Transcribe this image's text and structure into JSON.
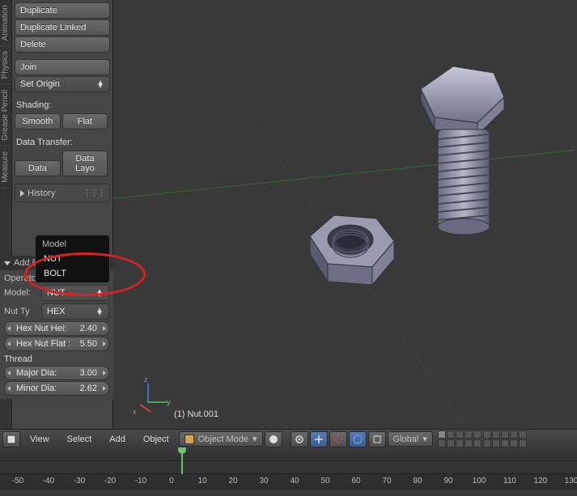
{
  "tabs": {
    "animation": "Animation",
    "physics": "Physics",
    "grease": "Grease Pencil",
    "measure": "Measure"
  },
  "toolshelf": {
    "duplicate": "Duplicate",
    "duplicate_linked": "Duplicate Linked",
    "delete": "Delete",
    "join": "Join",
    "set_origin": "Set Origin",
    "shading_label": "Shading:",
    "smooth": "Smooth",
    "flat": "Flat",
    "data_transfer_label": "Data Transfer:",
    "data": "Data",
    "data_layout": "Data Layo",
    "history": "History"
  },
  "popup": {
    "title": "Model",
    "nut": "NUT",
    "bolt": "BOLT"
  },
  "operator": {
    "title": "Add B",
    "presets_label": "Operato",
    "model_label": "Model:",
    "model_value": "NUT",
    "nut_type_label": "Nut Ty",
    "nut_type_value": "HEX",
    "hex_nut_height_label": "Hex Nut Hei:",
    "hex_nut_height_value": "2.40",
    "hex_nut_flat_label": "Hex Nut Flat :",
    "hex_nut_flat_value": "5.50",
    "thread_label": "Thread",
    "major_dia_label": "Major Dia:",
    "major_dia_value": "3.00",
    "minor_dia_label": "Minor Dia:",
    "minor_dia_value": "2.62"
  },
  "viewport": {
    "object_label": "(1) Nut.001",
    "axis_x": "x",
    "axis_y": "y",
    "axis_z": "z"
  },
  "header": {
    "view": "View",
    "select": "Select",
    "add": "Add",
    "object": "Object",
    "mode": "Object Mode",
    "orientation": "Global"
  },
  "timeline": {
    "ticks": [
      "-50",
      "-40",
      "-30",
      "-20",
      "-10",
      "0",
      "10",
      "20",
      "30",
      "40",
      "50",
      "60",
      "70",
      "80",
      "90",
      "100",
      "110",
      "120",
      "130"
    ]
  }
}
